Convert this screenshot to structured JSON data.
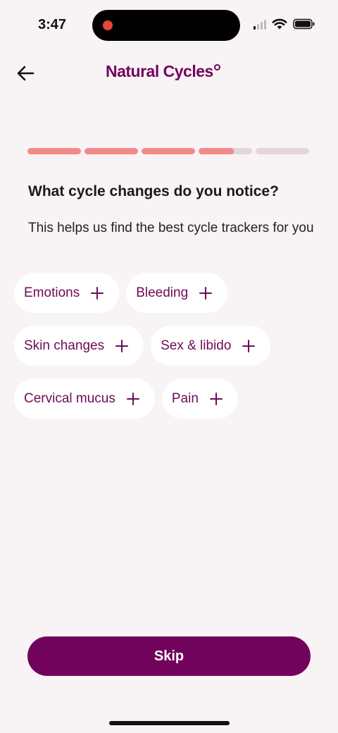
{
  "status_bar": {
    "time": "3:47",
    "icons": [
      "cellular-signal-icon",
      "wifi-icon",
      "battery-icon"
    ]
  },
  "header": {
    "logo_text": "Natural Cycles",
    "back_icon": "arrow-left-icon"
  },
  "progress": {
    "segments": [
      1,
      1,
      1,
      0.66,
      0
    ]
  },
  "main": {
    "question": "What cycle changes do you notice?",
    "subtitle": "This helps us find the best cycle trackers for you",
    "chips": [
      {
        "label": "Emotions",
        "icon": "plus-icon"
      },
      {
        "label": "Bleeding",
        "icon": "plus-icon"
      },
      {
        "label": "Skin changes",
        "icon": "plus-icon"
      },
      {
        "label": "Sex & libido",
        "icon": "plus-icon"
      },
      {
        "label": "Cervical mucus",
        "icon": "plus-icon"
      },
      {
        "label": "Pain",
        "icon": "plus-icon"
      }
    ]
  },
  "footer": {
    "skip_label": "Skip"
  },
  "colors": {
    "brand": "#72035d",
    "progress_fill": "#f28a8a",
    "progress_track": "#e4d7da",
    "background": "#f8f3f4",
    "chip_bg": "#ffffff"
  }
}
